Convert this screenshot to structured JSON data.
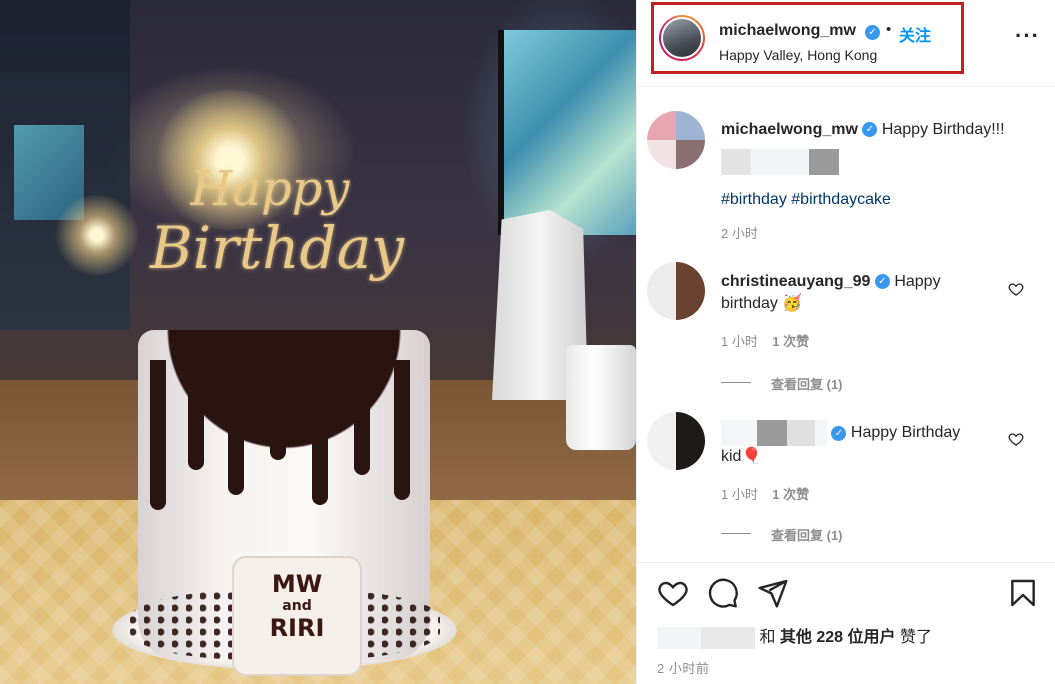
{
  "photo": {
    "topper_line1": "Happy",
    "topper_line2": "Birthday",
    "plaque_line1": "MW",
    "plaque_line2": "and",
    "plaque_line3": "RIRI"
  },
  "header": {
    "username": "michaelwong_mw",
    "verified_icon": "verified-badge-icon",
    "separator": "•",
    "follow_label": "关注",
    "location": "Happy Valley, Hong Kong",
    "more_icon": "more-options-icon",
    "highlight_color": "#c42021"
  },
  "caption": {
    "username": "michaelwong_mw",
    "text": "Happy Birthday!!!",
    "hashtags": [
      "#birthday",
      "#birthdaycake"
    ],
    "time": "2 小时"
  },
  "comments": [
    {
      "username": "christineauyang_99",
      "text_line1": "Happy",
      "text_line2": "birthday 🥳",
      "time": "1 小时",
      "likes": "1 次赞",
      "view_replies": "查看回复 (1)"
    },
    {
      "username": "",
      "text_line1": "Happy Birthday",
      "text_line2": "kid🎈",
      "time": "1 小时",
      "likes": "1 次赞",
      "view_replies": "查看回复 (1)"
    }
  ],
  "actions": {
    "like_icon": "heart-icon",
    "comment_icon": "comment-icon",
    "share_icon": "send-icon",
    "save_icon": "bookmark-icon",
    "likes_prefix": "和",
    "likes_bold": "其他 228 位用户",
    "likes_suffix": "赞了",
    "time": "2 小时前"
  },
  "colors": {
    "accent": "#0095f6",
    "verified": "#3897f0",
    "text": "#262626",
    "muted": "#8e8e8e",
    "hashtag": "#00376b"
  }
}
